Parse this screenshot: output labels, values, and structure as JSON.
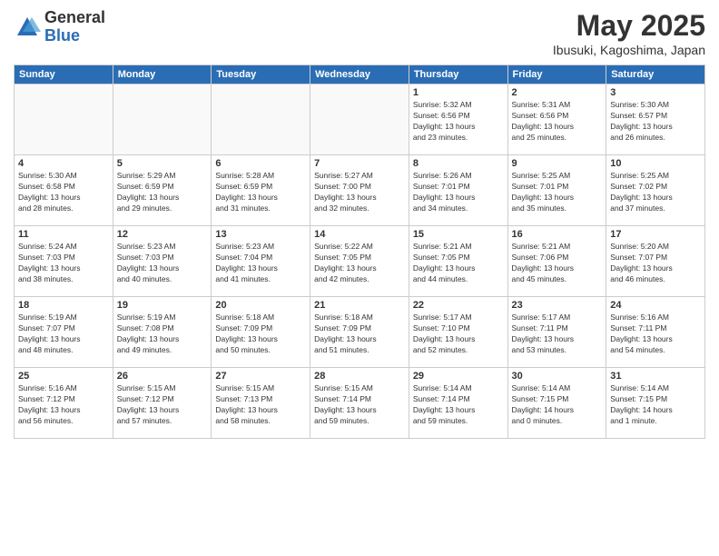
{
  "logo": {
    "general": "General",
    "blue": "Blue"
  },
  "title": "May 2025",
  "location": "Ibusuki, Kagoshima, Japan",
  "days_of_week": [
    "Sunday",
    "Monday",
    "Tuesday",
    "Wednesday",
    "Thursday",
    "Friday",
    "Saturday"
  ],
  "weeks": [
    [
      {
        "day": "",
        "content": ""
      },
      {
        "day": "",
        "content": ""
      },
      {
        "day": "",
        "content": ""
      },
      {
        "day": "",
        "content": ""
      },
      {
        "day": "1",
        "content": "Sunrise: 5:32 AM\nSunset: 6:56 PM\nDaylight: 13 hours\nand 23 minutes."
      },
      {
        "day": "2",
        "content": "Sunrise: 5:31 AM\nSunset: 6:56 PM\nDaylight: 13 hours\nand 25 minutes."
      },
      {
        "day": "3",
        "content": "Sunrise: 5:30 AM\nSunset: 6:57 PM\nDaylight: 13 hours\nand 26 minutes."
      }
    ],
    [
      {
        "day": "4",
        "content": "Sunrise: 5:30 AM\nSunset: 6:58 PM\nDaylight: 13 hours\nand 28 minutes."
      },
      {
        "day": "5",
        "content": "Sunrise: 5:29 AM\nSunset: 6:59 PM\nDaylight: 13 hours\nand 29 minutes."
      },
      {
        "day": "6",
        "content": "Sunrise: 5:28 AM\nSunset: 6:59 PM\nDaylight: 13 hours\nand 31 minutes."
      },
      {
        "day": "7",
        "content": "Sunrise: 5:27 AM\nSunset: 7:00 PM\nDaylight: 13 hours\nand 32 minutes."
      },
      {
        "day": "8",
        "content": "Sunrise: 5:26 AM\nSunset: 7:01 PM\nDaylight: 13 hours\nand 34 minutes."
      },
      {
        "day": "9",
        "content": "Sunrise: 5:25 AM\nSunset: 7:01 PM\nDaylight: 13 hours\nand 35 minutes."
      },
      {
        "day": "10",
        "content": "Sunrise: 5:25 AM\nSunset: 7:02 PM\nDaylight: 13 hours\nand 37 minutes."
      }
    ],
    [
      {
        "day": "11",
        "content": "Sunrise: 5:24 AM\nSunset: 7:03 PM\nDaylight: 13 hours\nand 38 minutes."
      },
      {
        "day": "12",
        "content": "Sunrise: 5:23 AM\nSunset: 7:03 PM\nDaylight: 13 hours\nand 40 minutes."
      },
      {
        "day": "13",
        "content": "Sunrise: 5:23 AM\nSunset: 7:04 PM\nDaylight: 13 hours\nand 41 minutes."
      },
      {
        "day": "14",
        "content": "Sunrise: 5:22 AM\nSunset: 7:05 PM\nDaylight: 13 hours\nand 42 minutes."
      },
      {
        "day": "15",
        "content": "Sunrise: 5:21 AM\nSunset: 7:05 PM\nDaylight: 13 hours\nand 44 minutes."
      },
      {
        "day": "16",
        "content": "Sunrise: 5:21 AM\nSunset: 7:06 PM\nDaylight: 13 hours\nand 45 minutes."
      },
      {
        "day": "17",
        "content": "Sunrise: 5:20 AM\nSunset: 7:07 PM\nDaylight: 13 hours\nand 46 minutes."
      }
    ],
    [
      {
        "day": "18",
        "content": "Sunrise: 5:19 AM\nSunset: 7:07 PM\nDaylight: 13 hours\nand 48 minutes."
      },
      {
        "day": "19",
        "content": "Sunrise: 5:19 AM\nSunset: 7:08 PM\nDaylight: 13 hours\nand 49 minutes."
      },
      {
        "day": "20",
        "content": "Sunrise: 5:18 AM\nSunset: 7:09 PM\nDaylight: 13 hours\nand 50 minutes."
      },
      {
        "day": "21",
        "content": "Sunrise: 5:18 AM\nSunset: 7:09 PM\nDaylight: 13 hours\nand 51 minutes."
      },
      {
        "day": "22",
        "content": "Sunrise: 5:17 AM\nSunset: 7:10 PM\nDaylight: 13 hours\nand 52 minutes."
      },
      {
        "day": "23",
        "content": "Sunrise: 5:17 AM\nSunset: 7:11 PM\nDaylight: 13 hours\nand 53 minutes."
      },
      {
        "day": "24",
        "content": "Sunrise: 5:16 AM\nSunset: 7:11 PM\nDaylight: 13 hours\nand 54 minutes."
      }
    ],
    [
      {
        "day": "25",
        "content": "Sunrise: 5:16 AM\nSunset: 7:12 PM\nDaylight: 13 hours\nand 56 minutes."
      },
      {
        "day": "26",
        "content": "Sunrise: 5:15 AM\nSunset: 7:12 PM\nDaylight: 13 hours\nand 57 minutes."
      },
      {
        "day": "27",
        "content": "Sunrise: 5:15 AM\nSunset: 7:13 PM\nDaylight: 13 hours\nand 58 minutes."
      },
      {
        "day": "28",
        "content": "Sunrise: 5:15 AM\nSunset: 7:14 PM\nDaylight: 13 hours\nand 59 minutes."
      },
      {
        "day": "29",
        "content": "Sunrise: 5:14 AM\nSunset: 7:14 PM\nDaylight: 13 hours\nand 59 minutes."
      },
      {
        "day": "30",
        "content": "Sunrise: 5:14 AM\nSunset: 7:15 PM\nDaylight: 14 hours\nand 0 minutes."
      },
      {
        "day": "31",
        "content": "Sunrise: 5:14 AM\nSunset: 7:15 PM\nDaylight: 14 hours\nand 1 minute."
      }
    ]
  ]
}
